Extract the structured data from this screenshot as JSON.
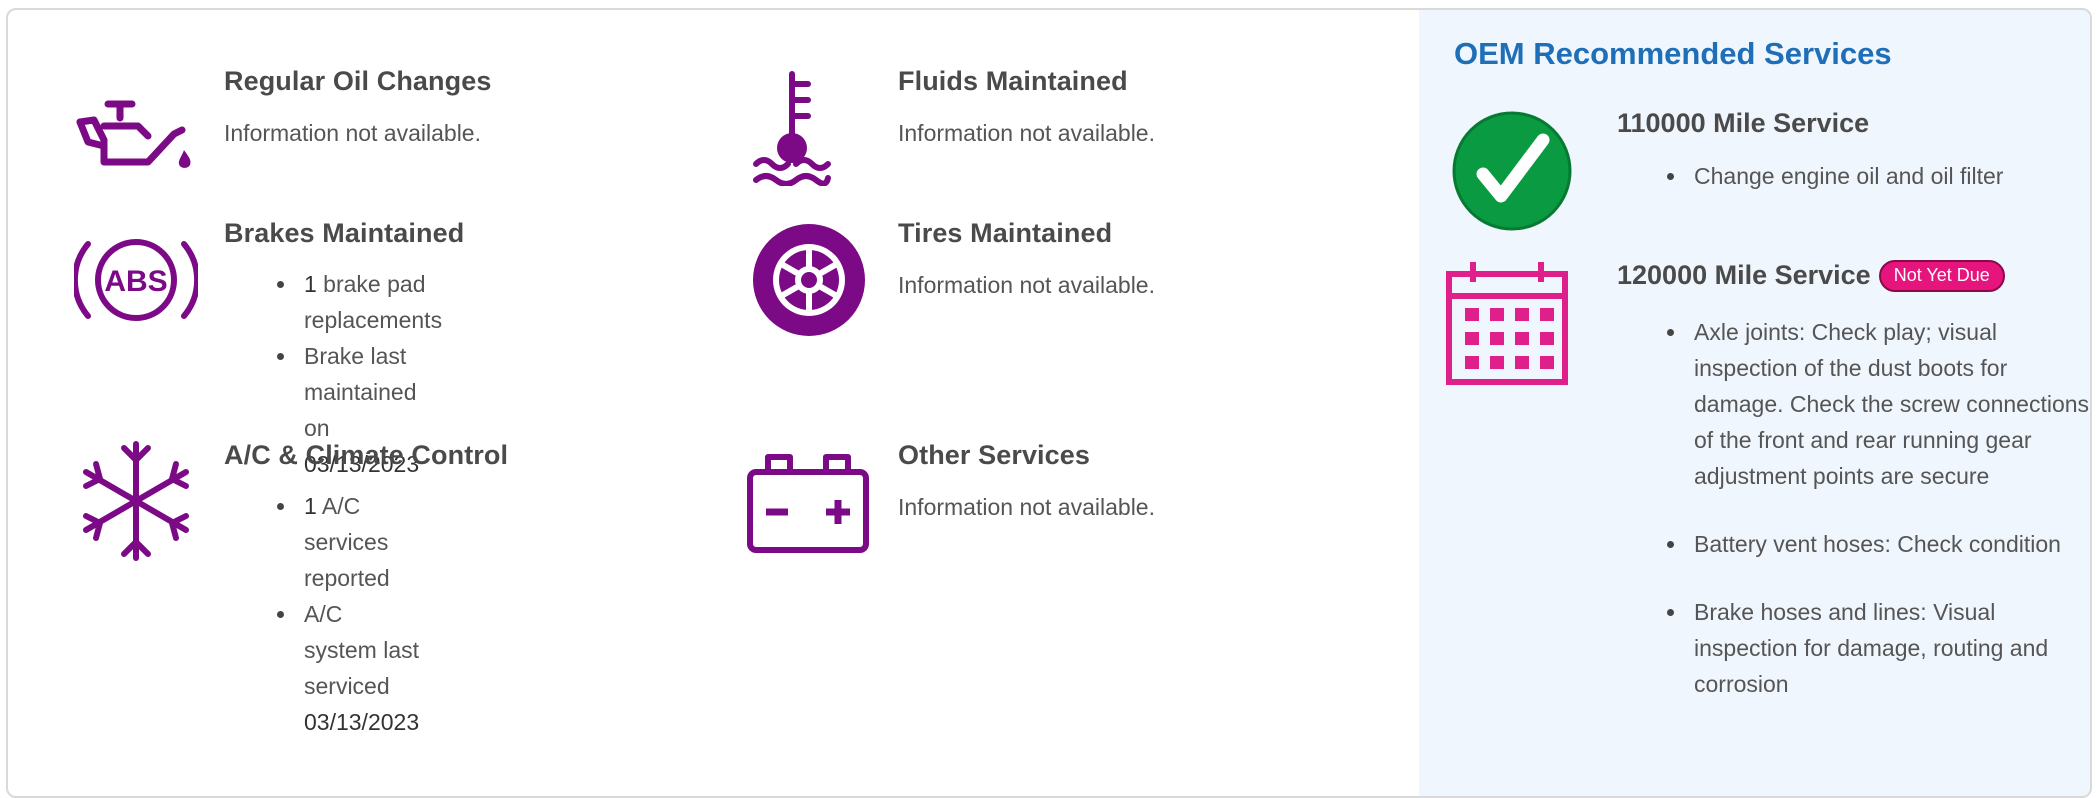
{
  "services": {
    "oil": {
      "title": "Regular Oil Changes",
      "info": "Information not available."
    },
    "fluids": {
      "title": "Fluids Maintained",
      "info": "Information not available."
    },
    "brakes": {
      "title": "Brakes Maintained",
      "item1_num": "1",
      "item1_text": " brake pad replacements",
      "item2_text": "Brake last maintained on",
      "item2_date": "03/13/2023"
    },
    "tires": {
      "title": "Tires Maintained",
      "info": "Information not available."
    },
    "ac": {
      "title": "A/C & Climate Control",
      "item1_num": "1",
      "item1_text": " A/C services reported",
      "item2_text": "A/C system last serviced",
      "item2_date": "03/13/2023"
    },
    "other": {
      "title": "Other Services",
      "info": "Information not available."
    }
  },
  "icons": {
    "oil": "oil-can-icon",
    "fluids": "coolant-temperature-icon",
    "brakes": "abs-brake-icon",
    "tires": "tire-wheel-icon",
    "ac": "snowflake-icon",
    "other": "battery-icon"
  },
  "oem": {
    "title": "OEM Recommended Services",
    "service1": {
      "title": "110000 Mile Service",
      "status_icon": "checkmark-icon",
      "items": [
        "Change engine oil and oil filter"
      ]
    },
    "service2": {
      "title": "120000 Mile Service",
      "badge": "Not Yet Due",
      "status_icon": "calendar-icon",
      "items": [
        "Axle joints: Check play; visual inspection of the dust boots for damage. Check the screw connections of the front and rear running gear adjustment points are secure",
        "Battery vent hoses: Check condition",
        "Brake hoses and lines: Visual inspection for damage, routing and corrosion"
      ]
    }
  },
  "colors": {
    "icon_purple": "#7c0a86",
    "oem_title_blue": "#1e6fb8",
    "check_green": "#0a9a41",
    "calendar_pink": "#e0208a",
    "badge_pink": "#e6157e",
    "oem_bg": "#f0f6fd"
  }
}
